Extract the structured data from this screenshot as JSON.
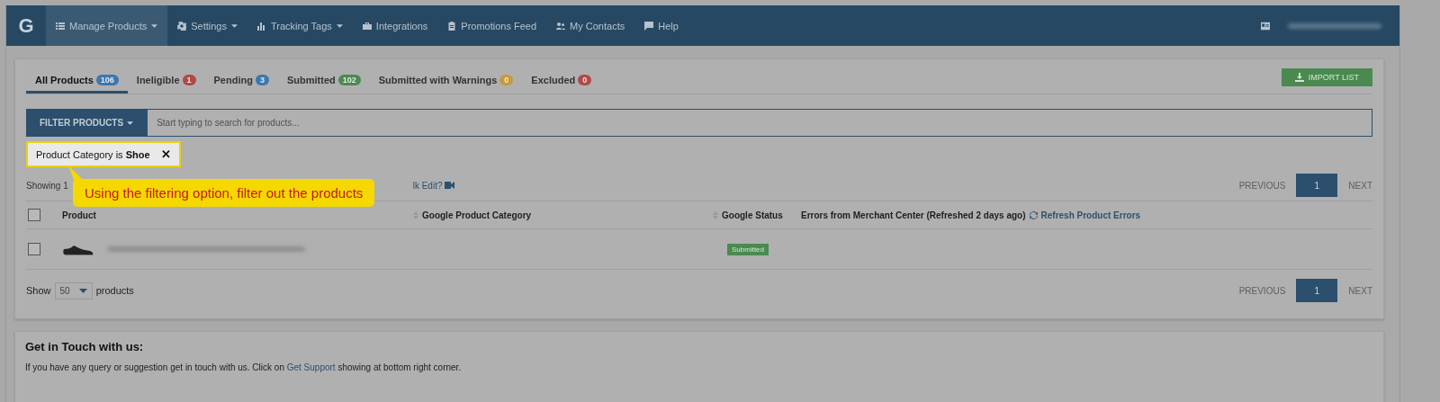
{
  "navbar": {
    "logo": "G",
    "items": [
      {
        "label": "Manage Products",
        "kind": "list",
        "caret": true,
        "selected": true
      },
      {
        "label": "Settings",
        "kind": "gear",
        "caret": true,
        "selected": false
      },
      {
        "label": "Tracking Tags",
        "kind": "bars",
        "caret": true,
        "selected": false
      },
      {
        "label": "Integrations",
        "kind": "briefcase",
        "caret": false,
        "selected": false
      },
      {
        "label": "Promotions Feed",
        "kind": "clipboard",
        "caret": false,
        "selected": false
      },
      {
        "label": "My Contacts",
        "kind": "people",
        "caret": false,
        "selected": false
      },
      {
        "label": "Help",
        "kind": "chat",
        "caret": false,
        "selected": false
      }
    ]
  },
  "tabs": [
    {
      "label": "All Products",
      "count": "106",
      "color": "#3b78b0",
      "selected": true
    },
    {
      "label": "Ineligible",
      "count": "1",
      "color": "#b04a48",
      "selected": false
    },
    {
      "label": "Pending",
      "count": "3",
      "color": "#3b78b0",
      "selected": false
    },
    {
      "label": "Submitted",
      "count": "102",
      "color": "#4a8a50",
      "selected": false
    },
    {
      "label": "Submitted with Warnings",
      "count": "0",
      "color": "#c49a3c",
      "selected": false
    },
    {
      "label": "Excluded",
      "count": "0",
      "color": "#b04a48",
      "selected": false
    }
  ],
  "import_button": "IMPORT LIST",
  "filter": {
    "button": "FILTER PRODUCTS",
    "placeholder": "Start typing to search for products..."
  },
  "chip": {
    "text": "Product Category is **Shoe**",
    "close": "✕"
  },
  "tooltip": "Using the filtering option, filter out the products",
  "showing": {
    "text": "Showing 1",
    "link": "lk Edit?"
  },
  "pagination": {
    "previous": "PREVIOUS",
    "page": "1",
    "next": "NEXT"
  },
  "table": {
    "columns": [
      {
        "label": "Product",
        "sortable": true
      },
      {
        "label": "Google Product Category",
        "sortable": true
      },
      {
        "label": "Google Status",
        "sortable": false
      },
      {
        "label": "Errors from Merchant Center (Refreshed 2 days ago)",
        "sortable": false
      }
    ],
    "refresh_link": "Refresh Product Errors",
    "header_checked": false,
    "rows": [
      {
        "checked": false,
        "status": "Submitted"
      }
    ]
  },
  "page_size": {
    "before": "Show",
    "value": "50",
    "after": "products"
  },
  "pagination_bottom": {
    "previous": "PREVIOUS",
    "page": "1",
    "next": "NEXT"
  },
  "contact": {
    "title": "Get in Touch with us:",
    "before": "If you have any query or suggestion get in touch with us. Click on ",
    "link": "Get Support",
    "after": " showing at bottom right corner."
  }
}
